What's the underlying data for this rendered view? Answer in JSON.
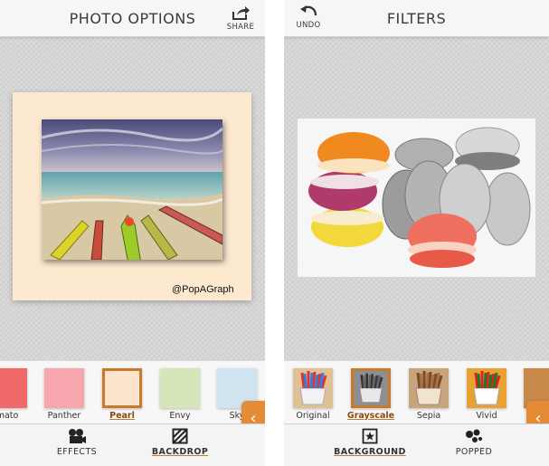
{
  "left_screen": {
    "title": "PHOTO OPTIONS",
    "share_label": "SHARE",
    "watermark": "@PopAGraph",
    "backdrops": [
      {
        "label": "mato",
        "color": "#f06a6a",
        "selected": false
      },
      {
        "label": "Panther",
        "color": "#f7a6ae",
        "selected": false
      },
      {
        "label": "Pearl",
        "color": "#fde4cc",
        "selected": true
      },
      {
        "label": "Envy",
        "color": "#d5e6b8",
        "selected": false
      },
      {
        "label": "Sky",
        "color": "#cfe3f1",
        "selected": false
      }
    ],
    "tabs": [
      {
        "label": "EFFECTS",
        "icon": "film-camera-icon",
        "active": false
      },
      {
        "label": "BACKDROP",
        "icon": "hatched-square-icon",
        "active": true
      }
    ],
    "collapse_icon": "chevron-left-icon"
  },
  "right_screen": {
    "title": "FILTERS",
    "undo_label": "UNDO",
    "filters": [
      {
        "label": "Original",
        "selected": false
      },
      {
        "label": "Grayscale",
        "selected": true
      },
      {
        "label": "Sepia",
        "selected": false
      },
      {
        "label": "Vivid",
        "selected": false
      }
    ],
    "tabs": [
      {
        "label": "BACKGROUND",
        "icon": "framed-star-icon",
        "active": true
      },
      {
        "label": "POPPED",
        "icon": "bubbles-icon",
        "active": false
      }
    ],
    "collapse_icon": "chevron-left-icon"
  },
  "colors": {
    "accent": "#e58b35",
    "accent_dark": "#c87a2a",
    "backdrop_pearl": "#fde9cf"
  }
}
